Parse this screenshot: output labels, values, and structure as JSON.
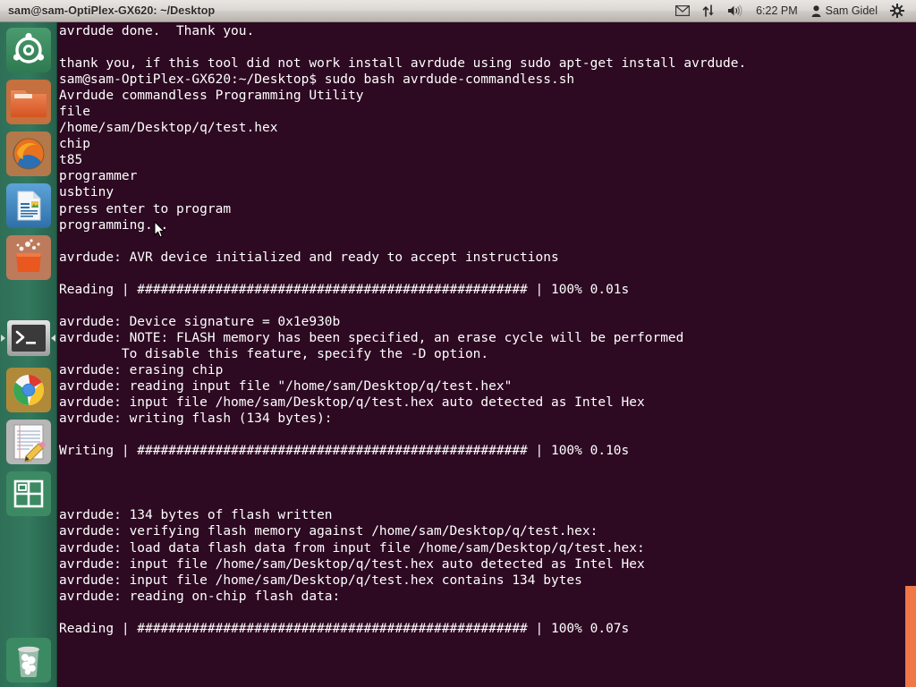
{
  "panel": {
    "window_title": "sam@sam-OptiPlex-GX620: ~/Desktop",
    "clock": "6:22 PM",
    "username": "Sam Gidel",
    "indicators": [
      {
        "name": "messaging-icon",
        "label": "Messaging"
      },
      {
        "name": "network-icon",
        "label": "Network"
      },
      {
        "name": "volume-icon",
        "label": "Volume"
      },
      {
        "name": "user-icon",
        "label": "User"
      },
      {
        "name": "gear-icon",
        "label": "System settings"
      }
    ]
  },
  "launcher": {
    "items": [
      {
        "name": "launcher-item-dash",
        "label": "Ubuntu Dash Home",
        "running": false,
        "focused": false
      },
      {
        "name": "launcher-item-files",
        "label": "Files",
        "running": false,
        "focused": false
      },
      {
        "name": "launcher-item-firefox",
        "label": "Firefox Web Browser",
        "running": false,
        "focused": false
      },
      {
        "name": "launcher-item-libreoffice-writer",
        "label": "LibreOffice Writer",
        "running": false,
        "focused": false
      },
      {
        "name": "launcher-item-software-center",
        "label": "Ubuntu Software Center",
        "running": false,
        "focused": false
      },
      {
        "name": "launcher-item-terminal",
        "label": "Terminal",
        "running": true,
        "focused": true
      },
      {
        "name": "launcher-item-chrome",
        "label": "Google Chrome",
        "running": false,
        "focused": false
      },
      {
        "name": "launcher-item-text-editor",
        "label": "Text Editor",
        "running": false,
        "focused": false
      },
      {
        "name": "launcher-item-workspace-switcher",
        "label": "Workspace Switcher",
        "running": false,
        "focused": false
      },
      {
        "name": "launcher-item-trash",
        "label": "Trash",
        "running": false,
        "focused": false
      }
    ]
  },
  "terminal": {
    "background_color": "#2d0922",
    "text_color": "#ffffff",
    "prompt": "sam@sam-OptiPlex-GX620:~/Desktop$",
    "command": "sudo bash avrdude-commandless.sh",
    "lines": [
      "avrdude done.  Thank you.",
      "",
      "thank you, if this tool did not work install avrdude using sudo apt-get install avrdude.",
      "sam@sam-OptiPlex-GX620:~/Desktop$ sudo bash avrdude-commandless.sh",
      "Avrdude commandless Programming Utility",
      "file",
      "/home/sam/Desktop/q/test.hex",
      "chip",
      "t85",
      "programmer",
      "usbtiny",
      "press enter to program",
      "programming...",
      "",
      "avrdude: AVR device initialized and ready to accept instructions",
      "",
      "Reading | ################################################## | 100% 0.01s",
      "",
      "avrdude: Device signature = 0x1e930b",
      "avrdude: NOTE: FLASH memory has been specified, an erase cycle will be performed",
      "        To disable this feature, specify the -D option.",
      "avrdude: erasing chip",
      "avrdude: reading input file \"/home/sam/Desktop/q/test.hex\"",
      "avrdude: input file /home/sam/Desktop/q/test.hex auto detected as Intel Hex",
      "avrdude: writing flash (134 bytes):",
      "",
      "Writing | ################################################## | 100% 0.10s",
      "",
      "",
      "",
      "avrdude: 134 bytes of flash written",
      "avrdude: verifying flash memory against /home/sam/Desktop/q/test.hex:",
      "avrdude: load data flash data from input file /home/sam/Desktop/q/test.hex:",
      "avrdude: input file /home/sam/Desktop/q/test.hex auto detected as Intel Hex",
      "avrdude: input file /home/sam/Desktop/q/test.hex contains 134 bytes",
      "avrdude: reading on-chip flash data:",
      "",
      "Reading | ################################################## | 100% 0.07s"
    ],
    "scrollbar": {
      "name": "terminal-scrollbar",
      "thumb_color": "#f07746",
      "position": "bottom"
    }
  }
}
